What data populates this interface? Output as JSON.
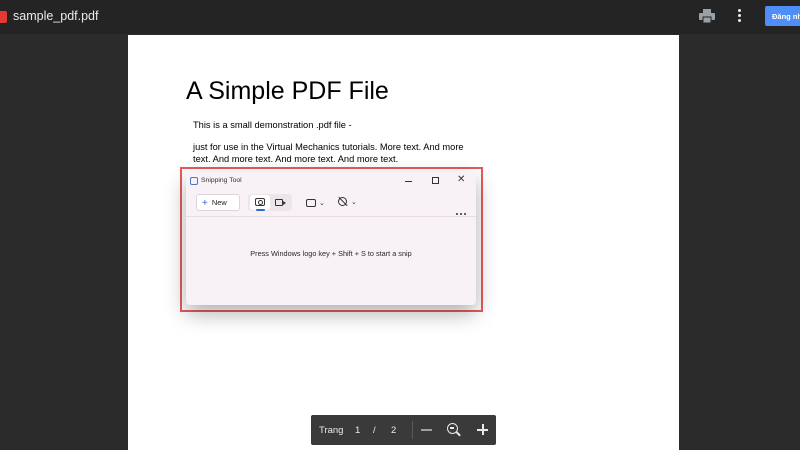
{
  "header": {
    "file_name": "sample_pdf.pdf",
    "sign_in_label": "Đăng nhập",
    "icons": {
      "file": "pdf-icon",
      "print": "print-icon",
      "more": "more-vert-icon"
    },
    "colors": {
      "bar": "#242424",
      "sign_in": "#4f8ef7"
    }
  },
  "document": {
    "title": "A Simple PDF File",
    "line1": "This is a small demonstration .pdf file -",
    "paragraph": "just for use in the Virtual Mechanics tutorials. More text. And more text. And more text. And more text. And more text."
  },
  "snipping_tool": {
    "title": "Snipping Tool",
    "new_label": "New",
    "hint": "Press Windows logo key + Shift + S to start a snip",
    "icons": [
      "snipping-tool-icon",
      "camera-icon",
      "video-icon",
      "snip-shape-icon",
      "timer-off-icon",
      "more-horizontal-icon"
    ],
    "colors": {
      "accent": "#2f6bd6",
      "highlight_border": "#e85a5a"
    }
  },
  "toolbar": {
    "page_label": "Trang",
    "current_page": "1",
    "separator": "/",
    "total_pages": "2",
    "icons": [
      "zoom-out-icon",
      "zoom-fit-icon",
      "zoom-in-icon"
    ]
  }
}
